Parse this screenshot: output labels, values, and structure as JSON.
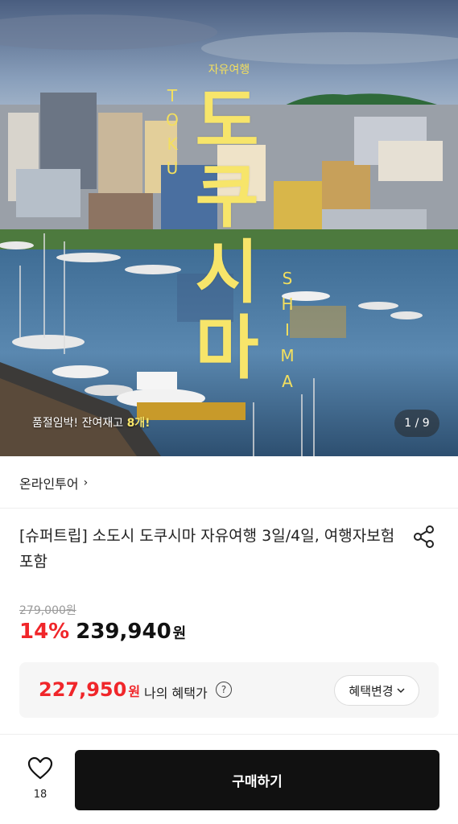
{
  "hero": {
    "tag": "자유여행",
    "title_chars": [
      "도",
      "쿠",
      "시",
      "마"
    ],
    "latin_left": [
      "T",
      "O",
      "K",
      "U"
    ],
    "latin_right": [
      "S",
      "H",
      "I",
      "M",
      "A"
    ],
    "stock_prefix": "품절임박! 잔여재고 ",
    "stock_count": "8개!",
    "counter": "1 / 9"
  },
  "shop": {
    "name": "온라인투어",
    "chevron": "›"
  },
  "product": {
    "title": "[슈퍼트립] 소도시 도쿠시마 자유여행 3일/4일, 여행자보험 포함"
  },
  "price": {
    "original": "279,000원",
    "discount": "14%",
    "sale": "239,940",
    "unit": "원"
  },
  "benefit": {
    "price": "227,950",
    "unit": "원",
    "label": "나의 혜택가",
    "help": "?",
    "change_label": "혜택변경",
    "caret": "⌄"
  },
  "bottom": {
    "like_count": "18",
    "buy_label": "구매하기"
  },
  "icons": {
    "share": "share-icon",
    "heart": "heart-icon",
    "help": "question-circle-icon"
  },
  "colors": {
    "accent_red": "#f0262a",
    "title_yellow": "#f7e56a",
    "buy_button": "#111111"
  }
}
